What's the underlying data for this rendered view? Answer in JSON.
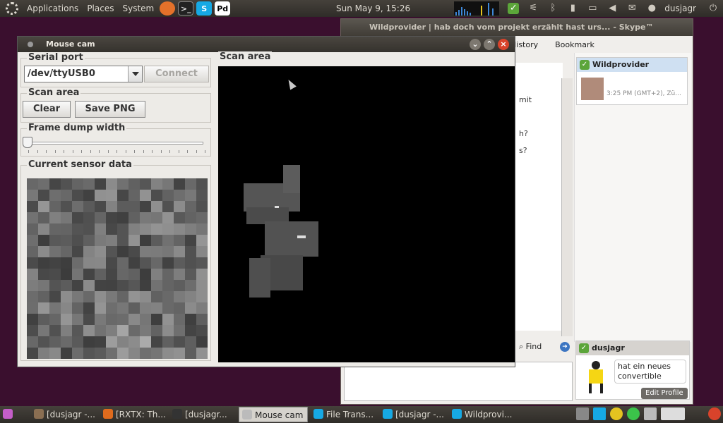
{
  "top_panel": {
    "menus": [
      "Applications",
      "Places",
      "System"
    ],
    "clock": "Sun May  9, 15:26",
    "user": "dusjagr",
    "launcher_labels": [
      "Pd"
    ]
  },
  "skype": {
    "title": "Wildprovider | hab doch vom projekt erzählt hast urs... - Skype™",
    "toolbar": {
      "history": "History",
      "bookmark": "Bookmark"
    },
    "chat_fragments": [
      "mit",
      "h?",
      "s?"
    ],
    "find_label": "Find",
    "contact": {
      "name": "Wildprovider",
      "time": "3:25 PM (GMT+2), Zü..."
    },
    "me": {
      "name": "dusjagr",
      "mood": "hat ein neues convertible",
      "edit_profile": "Edit Profile"
    }
  },
  "mouse_cam": {
    "title": "Mouse cam",
    "serial_port": {
      "label": "Serial port",
      "value": "/dev/ttyUSB0",
      "connect": "Connect"
    },
    "scan_area_controls": {
      "label": "Scan area",
      "clear": "Clear",
      "save": "Save PNG"
    },
    "frame_dump": {
      "label": "Frame dump width",
      "value": 0
    },
    "sensor": {
      "label": "Current sensor data"
    },
    "scan_area": {
      "label": "Scan area"
    }
  },
  "taskbar": {
    "tasks": [
      {
        "label": "[dusjagr -...",
        "icon_color": "#8a6e52"
      },
      {
        "label": "[RXTX: Th...",
        "icon_color": "#e06b1d"
      },
      {
        "label": "[dusjagr...",
        "icon_color": "#333333"
      },
      {
        "label": "Mouse cam",
        "icon_color": "#d6d3cd",
        "active": true
      },
      {
        "label": "File Trans...",
        "icon_color": "#16a9e4"
      },
      {
        "label": "[dusjagr -...",
        "icon_color": "#16a9e4"
      },
      {
        "label": "Wildprovi...",
        "icon_color": "#16a9e4"
      }
    ]
  },
  "colors": {
    "desktop": "#3a0f2e",
    "skype_blue": "#16a9e4",
    "online_green": "#5ca53a",
    "close_red": "#d9432b"
  }
}
